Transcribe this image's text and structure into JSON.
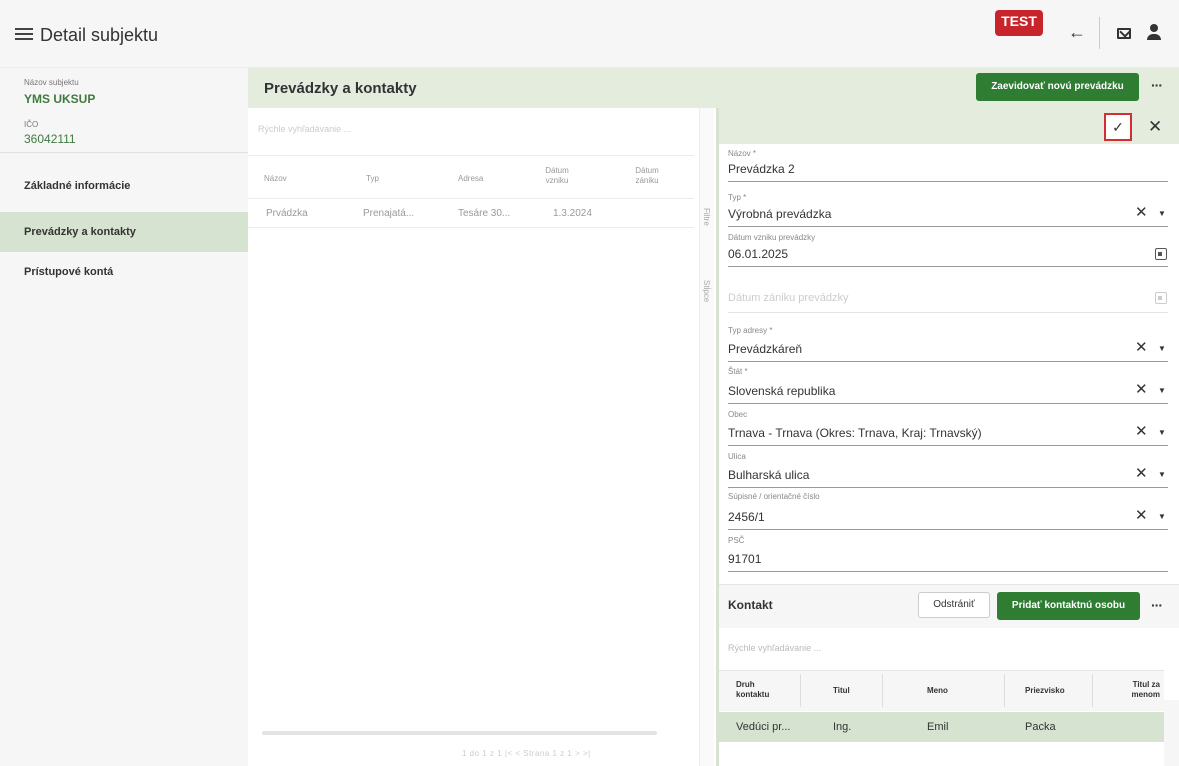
{
  "app": {
    "title": "Detail subjektu",
    "test_badge": "TEST"
  },
  "sidebar": {
    "name_label": "Názov subjektu",
    "name_value": "YMS UKSUP",
    "ico_label": "IČO",
    "ico_value": "36042111",
    "items": [
      {
        "label": "Základné informácie",
        "active": false
      },
      {
        "label": "Prevádzky a kontakty",
        "active": true
      },
      {
        "label": "Prístupové kontá",
        "active": false
      }
    ]
  },
  "main": {
    "title": "Prevádzky a kontakty",
    "new_button": "Zaevidovať novú prevádzku",
    "search_placeholder": "Rýchle vyhľadávanie ...",
    "columns": [
      "Názov",
      "Typ",
      "Adresa",
      "Dátum vzniku",
      "Dátum zániku"
    ],
    "rows": [
      {
        "nazov": "Prvádzka",
        "typ": "Prenajatá...",
        "adresa": "Tesáre 30...",
        "datum": "1.3.2024"
      }
    ],
    "side_tabs": [
      "Filtre",
      "Stĺpce"
    ],
    "pager": "1 do 1 z 1   |<   <   Strana  1  z 1   >   >|"
  },
  "detail": {
    "fields": [
      {
        "label": "Názov *",
        "value": "Prevádzka 2"
      },
      {
        "label": "Typ *",
        "value": "Výrobná prevádzka"
      },
      {
        "label": "Dátum vzniku prevádzky",
        "value": "06.01.2025"
      },
      {
        "label": "",
        "value": "Dátum zániku prevádzky"
      },
      {
        "label": "Typ adresy *",
        "value": "Prevádzkáreň"
      },
      {
        "label": "Štát *",
        "value": "Slovenská republika"
      },
      {
        "label": "Obec",
        "value": "Trnava - Trnava (Okres: Trnava, Kraj: Trnavský)"
      },
      {
        "label": "Ulica",
        "value": "Bulharská ulica"
      },
      {
        "label": "Súpisné / orientačné číslo",
        "value": "2456/1"
      },
      {
        "label": "PSČ",
        "value": "91701"
      }
    ]
  },
  "kontakt": {
    "title": "Kontakt",
    "remove_button": "Odstrániť",
    "add_button": "Pridať kontaktnú osobu",
    "search_placeholder": "Rýchle vyhľadávanie ...",
    "columns": [
      "Druh kontaktu",
      "Titul",
      "Meno",
      "Priezvisko",
      "Titul za menom"
    ],
    "rows": [
      {
        "druh": "Vedúci pr...",
        "titul": "Ing.",
        "meno": "Emil",
        "priezvisko": "Packa"
      }
    ]
  },
  "colors": {
    "accent_green": "#2e7d32",
    "header_green": "#e3ecdd",
    "selected_green": "#d6e3d0",
    "test_red": "#c8242c"
  }
}
